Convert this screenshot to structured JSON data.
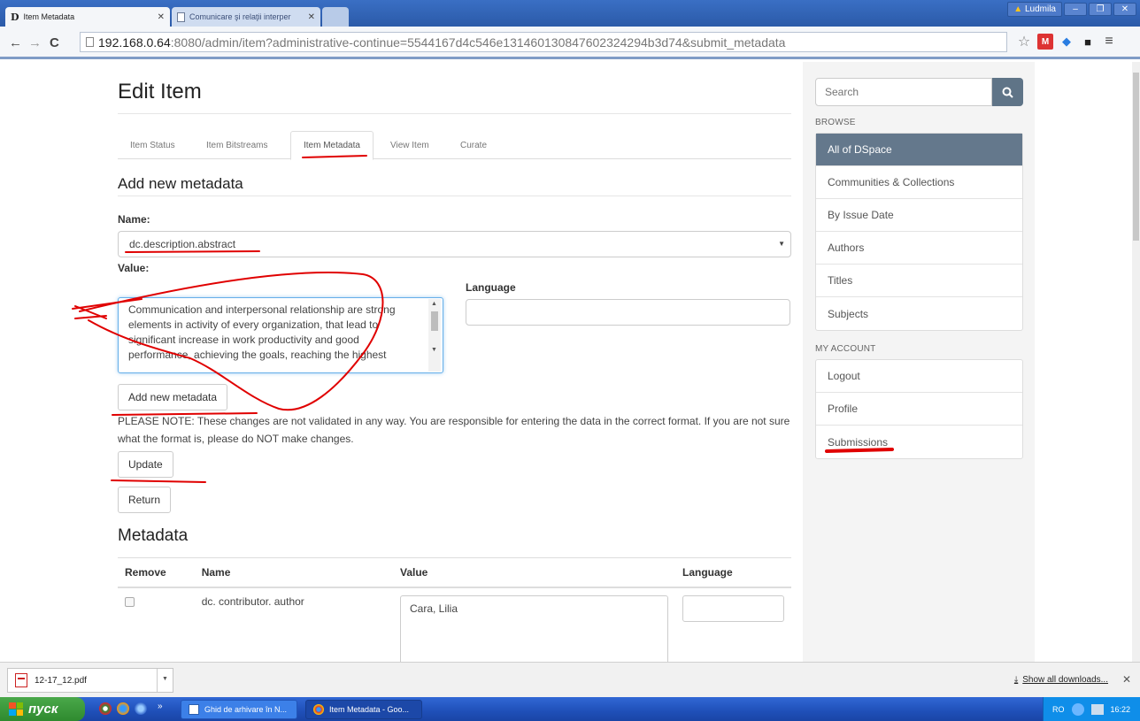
{
  "browser": {
    "tabs": [
      {
        "title": "Item Metadata",
        "active": true
      },
      {
        "title": "Comunicare şi relaţii interper",
        "active": false
      }
    ],
    "user": "Ludmila",
    "url_host": "192.168.0.64",
    "url_path": ":8080/admin/item?administrative-continue=5544167d4c546e131460130847602324294b3d74&submit_metadata",
    "nav_icons": {
      "back": "back-arrow-icon",
      "forward": "forward-arrow-icon",
      "reload": "reload-icon",
      "page": "page-icon",
      "star": "star-icon"
    }
  },
  "main": {
    "title": "Edit Item",
    "tabs": [
      {
        "label": "Item Status"
      },
      {
        "label": "Item Bitstreams"
      },
      {
        "label": "Item Metadata",
        "active": true
      },
      {
        "label": "View Item"
      },
      {
        "label": "Curate"
      }
    ],
    "add_section_title": "Add new metadata",
    "name_label": "Name:",
    "name_value": "dc.description.abstract",
    "value_label": "Value:",
    "value_text": "Communication and interpersonal relationship are strong elements in activity of every organization, that lead to significant increase in work productivity and good performance, achieving the goals, reaching the highest",
    "language_label": "Language",
    "add_button": "Add new metadata",
    "note": "PLEASE NOTE: These changes are not validated in any way. You are responsible for entering the data in the correct format. If you are not sure what the format is, please do NOT make changes.",
    "update_button": "Update",
    "return_button": "Return",
    "metadata_title": "Metadata",
    "table": {
      "headers": [
        "Remove",
        "Name",
        "Value",
        "Language"
      ],
      "rows": [
        {
          "name": "dc. contributor. author",
          "value": "Cara, Lilia",
          "language": ""
        }
      ]
    }
  },
  "sidebar": {
    "search_placeholder": "Search",
    "browse_heading": "BROWSE",
    "browse_items": [
      {
        "label": "All of DSpace",
        "active": true
      },
      {
        "label": "Communities & Collections"
      },
      {
        "label": "By Issue Date"
      },
      {
        "label": "Authors"
      },
      {
        "label": "Titles"
      },
      {
        "label": "Subjects"
      }
    ],
    "account_heading": "MY ACCOUNT",
    "account_items": [
      {
        "label": "Logout"
      },
      {
        "label": "Profile"
      },
      {
        "label": "Submissions"
      }
    ]
  },
  "downloads": {
    "file": "12-17_12.pdf",
    "show_all": "Show all downloads..."
  },
  "taskbar": {
    "start": "пуск",
    "tasks": [
      {
        "label": "Ghid de arhivare în N..."
      },
      {
        "label": "Item Metadata - Goo..."
      }
    ],
    "lang": "RO",
    "clock": "16:22"
  },
  "colors": {
    "sidebar_active": "#64788c",
    "search_button": "#5f7487",
    "annotation": "#e00000",
    "taskbar": "#245edb"
  }
}
